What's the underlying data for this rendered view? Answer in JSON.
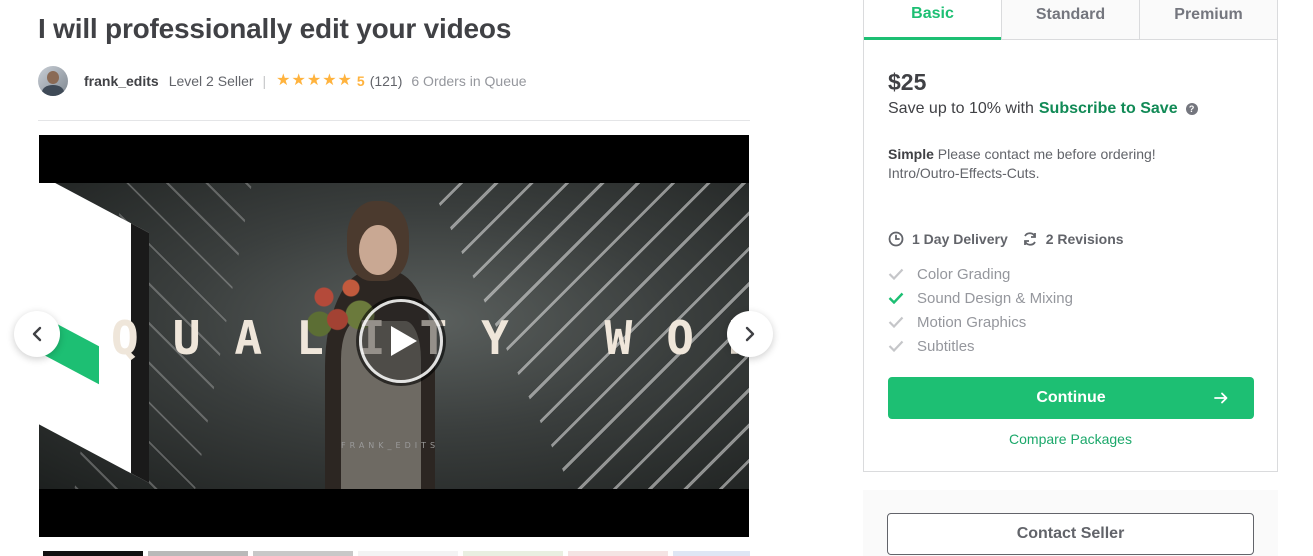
{
  "gig": {
    "title": "I will professionally edit your videos"
  },
  "seller": {
    "name": "frank_edits",
    "level": "Level 2 Seller",
    "separator": "|",
    "rating": "5",
    "reviews": "(121)",
    "queue": "6 Orders in Queue",
    "star_count": 5
  },
  "video": {
    "overlay_text": "QUALITY WORK",
    "watermark": "FRANK_EDITS"
  },
  "package": {
    "tabs": [
      {
        "label": "Basic",
        "active": true
      },
      {
        "label": "Standard",
        "active": false
      },
      {
        "label": "Premium",
        "active": false
      }
    ],
    "price": "$25",
    "save_prefix": "Save up to 10% with",
    "save_link": "Subscribe to Save",
    "help_icon": "?",
    "desc_title": "Simple",
    "desc_text": "Please contact me before ordering! Intro/Outro-Effects-Cuts.",
    "delivery": "1 Day Delivery",
    "revisions": "2 Revisions",
    "features": [
      {
        "label": "Color Grading",
        "included": false
      },
      {
        "label": "Sound Design & Mixing",
        "included": true
      },
      {
        "label": "Motion Graphics",
        "included": false
      },
      {
        "label": "Subtitles",
        "included": false
      }
    ],
    "continue_label": "Continue",
    "compare_label": "Compare Packages"
  },
  "contact": {
    "button_label": "Contact Seller"
  },
  "colors": {
    "accent": "#1dbf73",
    "star": "#ffb33e",
    "text": "#404145",
    "muted": "#95979d"
  },
  "thumbnails": [
    {
      "color": "#111111"
    },
    {
      "color": "#b9b9b9"
    },
    {
      "color": "#c8c8c8"
    },
    {
      "color": "#ffffff"
    },
    {
      "color": "#e9efe1"
    },
    {
      "color": "#f4e3e3"
    },
    {
      "color": "#dfe6f4"
    }
  ]
}
